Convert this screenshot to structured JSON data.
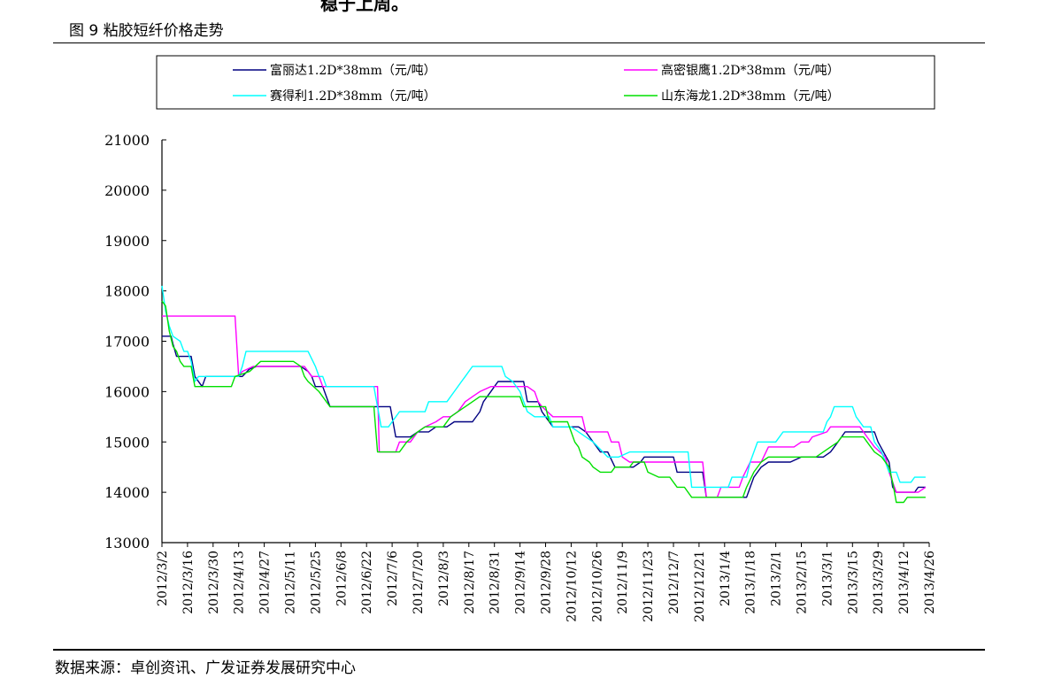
{
  "header": {
    "top_cut_text": "稳于上周。",
    "figure_title": "图 9 粘胶短纤价格走势"
  },
  "footer": {
    "source": "数据来源：卓创资讯、广发证券发展研究中心"
  },
  "chart_data": {
    "type": "line",
    "title": "",
    "xlabel": "",
    "ylabel": "",
    "ylim": [
      13000,
      21000
    ],
    "yticks": [
      13000,
      14000,
      15000,
      16000,
      17000,
      18000,
      19000,
      20000,
      21000
    ],
    "xtick_labels": [
      "2012/3/2",
      "2012/3/16",
      "2012/3/30",
      "2012/4/13",
      "2012/4/27",
      "2012/5/11",
      "2012/5/25",
      "2012/6/8",
      "2012/6/22",
      "2012/7/6",
      "2012/7/20",
      "2012/8/3",
      "2012/8/17",
      "2012/8/31",
      "2012/9/14",
      "2012/9/28",
      "2012/10/12",
      "2012/10/26",
      "2012/11/9",
      "2012/11/23",
      "2012/12/7",
      "2012/12/21",
      "2013/1/4",
      "2013/1/18",
      "2013/2/1",
      "2013/2/15",
      "2013/3/1",
      "2013/3/15",
      "2013/3/29",
      "2013/4/12",
      "2013/4/26"
    ],
    "legend_position": "top",
    "grid": false,
    "series": [
      {
        "name": "富丽达1.2D*38mm（元/吨）",
        "color": "#000080",
        "points": [
          [
            0,
            17100
          ],
          [
            5,
            17100
          ],
          [
            6,
            16950
          ],
          [
            8,
            16700
          ],
          [
            12,
            16700
          ],
          [
            16,
            16700
          ],
          [
            18,
            16300
          ],
          [
            22,
            16100
          ],
          [
            24,
            16300
          ],
          [
            40,
            16300
          ],
          [
            44,
            16300
          ],
          [
            48,
            16450
          ],
          [
            52,
            16500
          ],
          [
            76,
            16500
          ],
          [
            80,
            16400
          ],
          [
            82,
            16300
          ],
          [
            84,
            16100
          ],
          [
            88,
            16100
          ],
          [
            92,
            15700
          ],
          [
            110,
            15700
          ],
          [
            125,
            15700
          ],
          [
            128,
            15100
          ],
          [
            136,
            15100
          ],
          [
            140,
            15200
          ],
          [
            146,
            15200
          ],
          [
            150,
            15300
          ],
          [
            156,
            15300
          ],
          [
            160,
            15400
          ],
          [
            170,
            15400
          ],
          [
            174,
            15600
          ],
          [
            176,
            15800
          ],
          [
            178,
            15900
          ],
          [
            180,
            16000
          ],
          [
            182,
            16100
          ],
          [
            184,
            16200
          ],
          [
            198,
            16200
          ],
          [
            200,
            15800
          ],
          [
            206,
            15800
          ],
          [
            208,
            15600
          ],
          [
            210,
            15500
          ],
          [
            214,
            15300
          ],
          [
            228,
            15300
          ],
          [
            232,
            15200
          ],
          [
            236,
            15000
          ],
          [
            240,
            14800
          ],
          [
            244,
            14800
          ],
          [
            248,
            14500
          ],
          [
            258,
            14500
          ],
          [
            262,
            14600
          ],
          [
            264,
            14700
          ],
          [
            280,
            14700
          ],
          [
            282,
            14400
          ],
          [
            296,
            14400
          ],
          [
            298,
            13900
          ],
          [
            320,
            13900
          ],
          [
            322,
            14100
          ],
          [
            324,
            14300
          ],
          [
            328,
            14500
          ],
          [
            332,
            14600
          ],
          [
            344,
            14600
          ],
          [
            350,
            14700
          ],
          [
            362,
            14700
          ],
          [
            366,
            14800
          ],
          [
            368,
            14900
          ],
          [
            370,
            15000
          ],
          [
            372,
            15100
          ],
          [
            374,
            15200
          ],
          [
            386,
            15200
          ],
          [
            390,
            15200
          ],
          [
            392,
            15000
          ],
          [
            398,
            14600
          ],
          [
            400,
            14100
          ],
          [
            402,
            14000
          ],
          [
            408,
            14000
          ],
          [
            412,
            14000
          ],
          [
            414,
            14100
          ],
          [
            418,
            14100
          ]
        ]
      },
      {
        "name": "高密银鹰1.2D*38mm（元/吨）",
        "color": "#ff00ff",
        "points": [
          [
            0,
            17500
          ],
          [
            40,
            17500
          ],
          [
            42,
            16300
          ],
          [
            44,
            16400
          ],
          [
            50,
            16500
          ],
          [
            78,
            16500
          ],
          [
            82,
            16300
          ],
          [
            86,
            16300
          ],
          [
            88,
            16100
          ],
          [
            110,
            16100
          ],
          [
            118,
            16100
          ],
          [
            119,
            14800
          ],
          [
            126,
            14800
          ],
          [
            128,
            14800
          ],
          [
            130,
            15000
          ],
          [
            136,
            15000
          ],
          [
            140,
            15200
          ],
          [
            144,
            15300
          ],
          [
            150,
            15400
          ],
          [
            154,
            15500
          ],
          [
            158,
            15500
          ],
          [
            162,
            15600
          ],
          [
            166,
            15800
          ],
          [
            170,
            15900
          ],
          [
            174,
            16000
          ],
          [
            180,
            16100
          ],
          [
            200,
            16100
          ],
          [
            204,
            16000
          ],
          [
            206,
            15800
          ],
          [
            208,
            15700
          ],
          [
            214,
            15500
          ],
          [
            230,
            15500
          ],
          [
            232,
            15200
          ],
          [
            244,
            15200
          ],
          [
            246,
            15000
          ],
          [
            250,
            15000
          ],
          [
            252,
            14700
          ],
          [
            256,
            14600
          ],
          [
            260,
            14600
          ],
          [
            278,
            14600
          ],
          [
            290,
            14600
          ],
          [
            292,
            14600
          ],
          [
            296,
            14600
          ],
          [
            298,
            13900
          ],
          [
            300,
            13900
          ],
          [
            304,
            13900
          ],
          [
            306,
            14100
          ],
          [
            310,
            14100
          ],
          [
            316,
            14100
          ],
          [
            318,
            14300
          ],
          [
            322,
            14600
          ],
          [
            328,
            14600
          ],
          [
            332,
            14900
          ],
          [
            340,
            14900
          ],
          [
            346,
            14900
          ],
          [
            350,
            15000
          ],
          [
            354,
            15000
          ],
          [
            356,
            15100
          ],
          [
            364,
            15200
          ],
          [
            366,
            15300
          ],
          [
            376,
            15300
          ],
          [
            382,
            15300
          ],
          [
            386,
            15100
          ],
          [
            390,
            14900
          ],
          [
            396,
            14700
          ],
          [
            398,
            14400
          ],
          [
            402,
            14000
          ],
          [
            414,
            14000
          ],
          [
            418,
            14100
          ]
        ]
      },
      {
        "name": "赛得利1.2D*38mm（元/吨）",
        "color": "#00ffff",
        "points": [
          [
            0,
            18100
          ],
          [
            2,
            17600
          ],
          [
            4,
            17300
          ],
          [
            6,
            17100
          ],
          [
            10,
            17000
          ],
          [
            12,
            16800
          ],
          [
            14,
            16800
          ],
          [
            16,
            16600
          ],
          [
            18,
            16200
          ],
          [
            20,
            16300
          ],
          [
            38,
            16300
          ],
          [
            42,
            16300
          ],
          [
            44,
            16500
          ],
          [
            46,
            16800
          ],
          [
            58,
            16800
          ],
          [
            80,
            16800
          ],
          [
            84,
            16500
          ],
          [
            86,
            16300
          ],
          [
            88,
            16300
          ],
          [
            90,
            16100
          ],
          [
            116,
            16100
          ],
          [
            120,
            15300
          ],
          [
            124,
            15300
          ],
          [
            126,
            15400
          ],
          [
            130,
            15600
          ],
          [
            144,
            15600
          ],
          [
            146,
            15800
          ],
          [
            156,
            15800
          ],
          [
            160,
            16000
          ],
          [
            164,
            16200
          ],
          [
            166,
            16300
          ],
          [
            170,
            16500
          ],
          [
            186,
            16500
          ],
          [
            188,
            16300
          ],
          [
            192,
            16200
          ],
          [
            196,
            16000
          ],
          [
            200,
            15600
          ],
          [
            204,
            15500
          ],
          [
            212,
            15500
          ],
          [
            214,
            15300
          ],
          [
            224,
            15300
          ],
          [
            228,
            15200
          ],
          [
            232,
            15100
          ],
          [
            236,
            15000
          ],
          [
            244,
            14700
          ],
          [
            250,
            14700
          ],
          [
            256,
            14800
          ],
          [
            276,
            14800
          ],
          [
            288,
            14800
          ],
          [
            290,
            14100
          ],
          [
            310,
            14100
          ],
          [
            312,
            14300
          ],
          [
            320,
            14300
          ],
          [
            322,
            14600
          ],
          [
            326,
            15000
          ],
          [
            336,
            15000
          ],
          [
            340,
            15200
          ],
          [
            362,
            15200
          ],
          [
            364,
            15400
          ],
          [
            366,
            15500
          ],
          [
            368,
            15700
          ],
          [
            378,
            15700
          ],
          [
            380,
            15500
          ],
          [
            384,
            15300
          ],
          [
            388,
            15300
          ],
          [
            390,
            15000
          ],
          [
            394,
            14800
          ],
          [
            396,
            14600
          ],
          [
            398,
            14400
          ],
          [
            402,
            14400
          ],
          [
            404,
            14200
          ],
          [
            410,
            14200
          ],
          [
            412,
            14300
          ],
          [
            418,
            14300
          ]
        ]
      },
      {
        "name": "山东海龙1.2D*38mm（元/吨）",
        "color": "#00e000",
        "points": [
          [
            0,
            17800
          ],
          [
            2,
            17700
          ],
          [
            4,
            17200
          ],
          [
            6,
            16900
          ],
          [
            8,
            16800
          ],
          [
            10,
            16600
          ],
          [
            12,
            16500
          ],
          [
            16,
            16500
          ],
          [
            18,
            16100
          ],
          [
            38,
            16100
          ],
          [
            40,
            16300
          ],
          [
            48,
            16400
          ],
          [
            54,
            16600
          ],
          [
            72,
            16600
          ],
          [
            76,
            16500
          ],
          [
            78,
            16300
          ],
          [
            80,
            16200
          ],
          [
            86,
            16000
          ],
          [
            92,
            15700
          ],
          [
            116,
            15700
          ],
          [
            118,
            14800
          ],
          [
            130,
            14800
          ],
          [
            134,
            15000
          ],
          [
            140,
            15200
          ],
          [
            144,
            15300
          ],
          [
            154,
            15300
          ],
          [
            158,
            15500
          ],
          [
            162,
            15600
          ],
          [
            166,
            15700
          ],
          [
            170,
            15800
          ],
          [
            174,
            15900
          ],
          [
            196,
            15900
          ],
          [
            198,
            15700
          ],
          [
            210,
            15700
          ],
          [
            212,
            15400
          ],
          [
            222,
            15400
          ],
          [
            224,
            15200
          ],
          [
            226,
            15000
          ],
          [
            228,
            14900
          ],
          [
            230,
            14700
          ],
          [
            234,
            14600
          ],
          [
            236,
            14500
          ],
          [
            240,
            14400
          ],
          [
            246,
            14400
          ],
          [
            248,
            14500
          ],
          [
            256,
            14500
          ],
          [
            258,
            14600
          ],
          [
            264,
            14600
          ],
          [
            266,
            14400
          ],
          [
            272,
            14300
          ],
          [
            278,
            14300
          ],
          [
            282,
            14100
          ],
          [
            286,
            14100
          ],
          [
            290,
            13900
          ],
          [
            318,
            13900
          ],
          [
            320,
            14100
          ],
          [
            324,
            14400
          ],
          [
            328,
            14600
          ],
          [
            332,
            14700
          ],
          [
            358,
            14700
          ],
          [
            362,
            14800
          ],
          [
            366,
            14900
          ],
          [
            370,
            15000
          ],
          [
            372,
            15100
          ],
          [
            384,
            15100
          ],
          [
            386,
            15000
          ],
          [
            390,
            14800
          ],
          [
            394,
            14700
          ],
          [
            398,
            14500
          ],
          [
            400,
            14200
          ],
          [
            402,
            13800
          ],
          [
            406,
            13800
          ],
          [
            408,
            13900
          ],
          [
            418,
            13900
          ]
        ]
      }
    ]
  }
}
